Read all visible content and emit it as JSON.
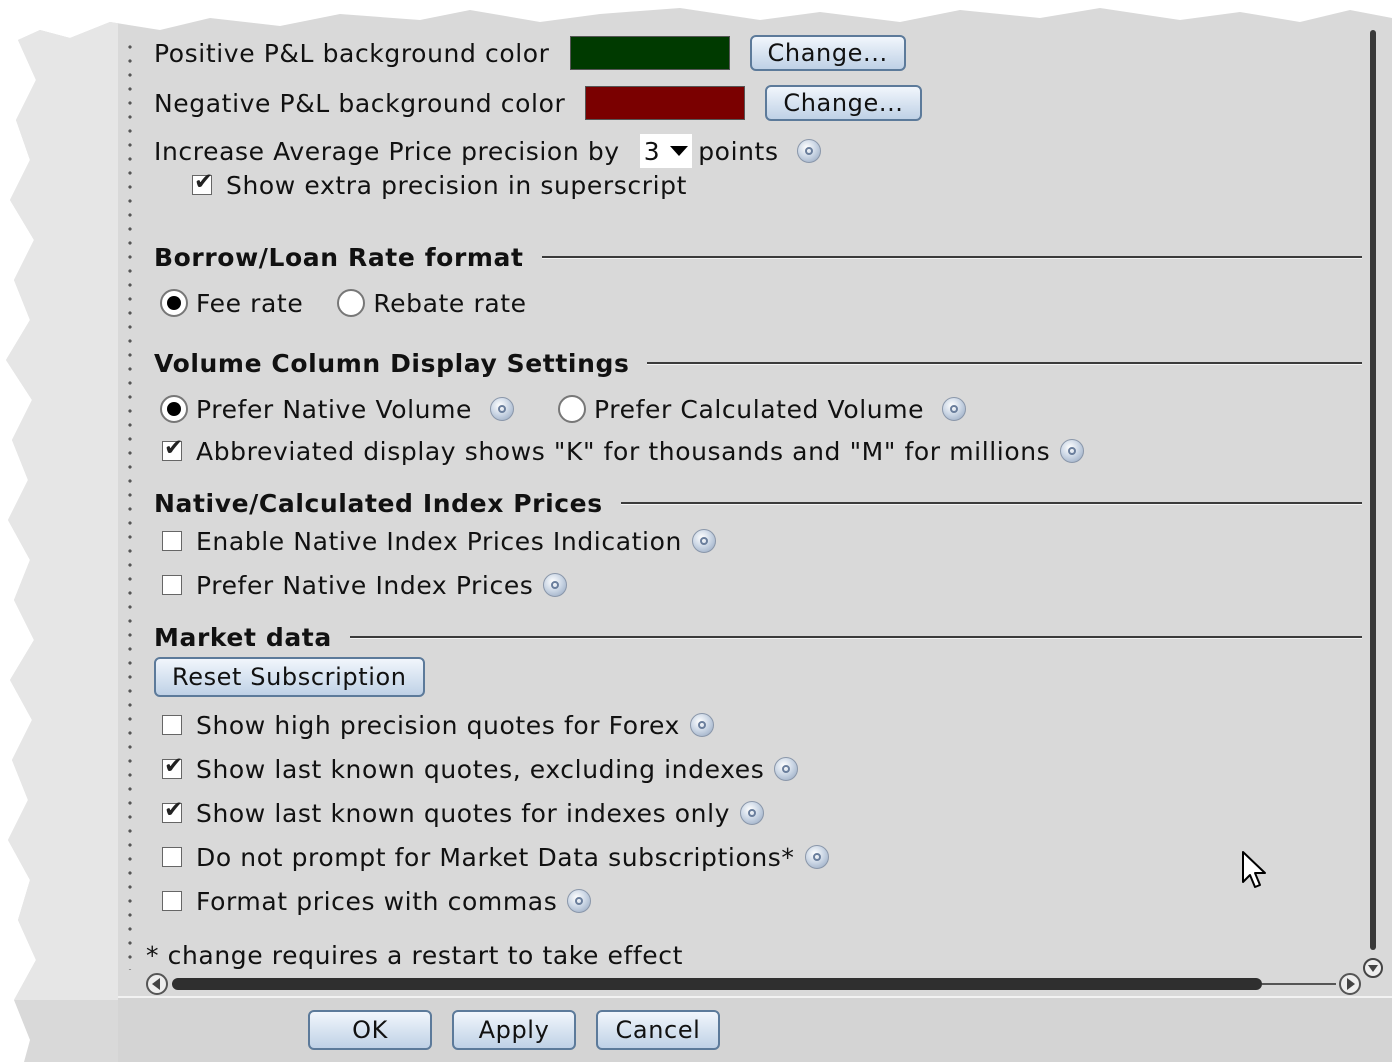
{
  "pnl": {
    "positive_label": "Positive P&L background color",
    "positive_color": "#003a00",
    "negative_label": "Negative P&L background color",
    "negative_color": "#7a0000",
    "change_label": "Change..."
  },
  "precision": {
    "prefix": "Increase Average Price precision by",
    "value": "3",
    "suffix": "points",
    "superscript_label": "Show extra precision in superscript",
    "superscript_checked": true
  },
  "borrow": {
    "heading": "Borrow/Loan Rate format",
    "fee_rate": "Fee rate",
    "rebate_rate": "Rebate rate",
    "selected": "fee"
  },
  "volume": {
    "heading": "Volume Column Display Settings",
    "native": "Prefer Native Volume",
    "calculated": "Prefer Calculated Volume",
    "selected": "native",
    "abbreviated": "Abbreviated display shows \"K\" for thousands and \"M\" for millions",
    "abbreviated_checked": true
  },
  "index": {
    "heading": "Native/Calculated Index Prices",
    "enable_native": "Enable Native Index Prices Indication",
    "prefer_native": "Prefer Native Index Prices"
  },
  "market": {
    "heading": "Market data",
    "reset": "Reset Subscription",
    "items": [
      {
        "label": "Show high precision quotes for Forex",
        "checked": false
      },
      {
        "label": "Show last known quotes, excluding indexes",
        "checked": true
      },
      {
        "label": "Show last known quotes for indexes only",
        "checked": true
      },
      {
        "label": "Do not prompt for Market Data subscriptions*",
        "checked": false
      },
      {
        "label": "Format prices with commas",
        "checked": false
      }
    ],
    "note": "* change requires a restart to take effect"
  },
  "footer": {
    "ok": "OK",
    "apply": "Apply",
    "cancel": "Cancel"
  }
}
